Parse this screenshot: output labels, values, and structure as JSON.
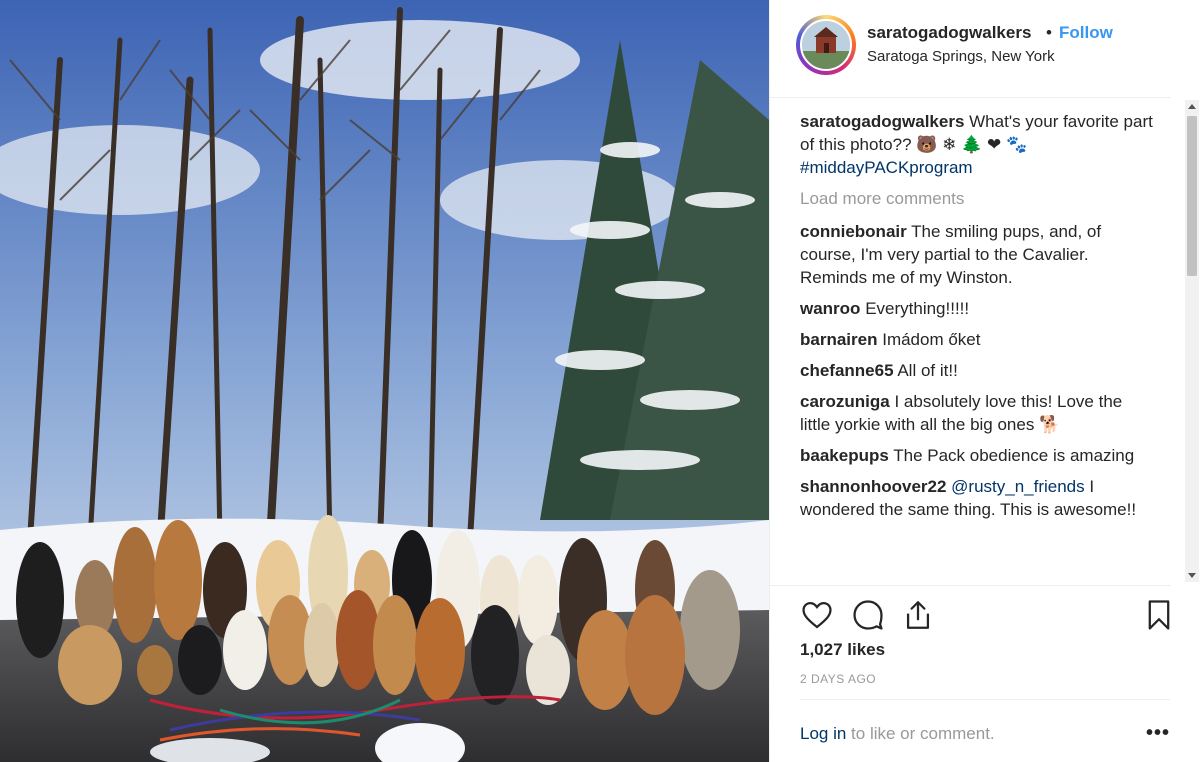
{
  "post": {
    "username": "saratogadogwalkers",
    "separator": "•",
    "follow_label": "Follow",
    "location": "Saratoga Springs, New York",
    "caption_text": "What's your favorite part of this photo?? 🐻 ❄ 🌲 ❤ 🐾",
    "caption_hashtag": "#middayPACKprogram",
    "load_more": "Load more comments",
    "likes": "1,027 likes",
    "time_ago": "2 DAYS AGO",
    "login_link": "Log in",
    "login_text": " to like or comment.",
    "more_label": "•••"
  },
  "comments": [
    {
      "user": "conniebonair",
      "text": "The smiling pups, and, of course, I'm very partial to the Cavalier. Reminds me of my Winston."
    },
    {
      "user": "wanroo",
      "text": "Everything!!!!!"
    },
    {
      "user": "barnairen",
      "text": "Imádom őket"
    },
    {
      "user": "chefanne65",
      "text": "All of it!!"
    },
    {
      "user": "carozuniga",
      "text": "I absolutely love this! Love the little yorkie with all the big ones 🐕"
    },
    {
      "user": "baakepups",
      "text": "The Pack obedience is amazing"
    },
    {
      "user": "shannonhoover22",
      "mention": "@rusty_n_friends",
      "text": "I wondered the same thing. This is awesome!!"
    }
  ],
  "icons": {
    "like": "heart-icon",
    "comment": "comment-icon",
    "share": "share-icon",
    "save": "bookmark-icon"
  },
  "colors": {
    "follow": "#3897f0",
    "hashtag": "#003569",
    "muted": "#999999"
  }
}
